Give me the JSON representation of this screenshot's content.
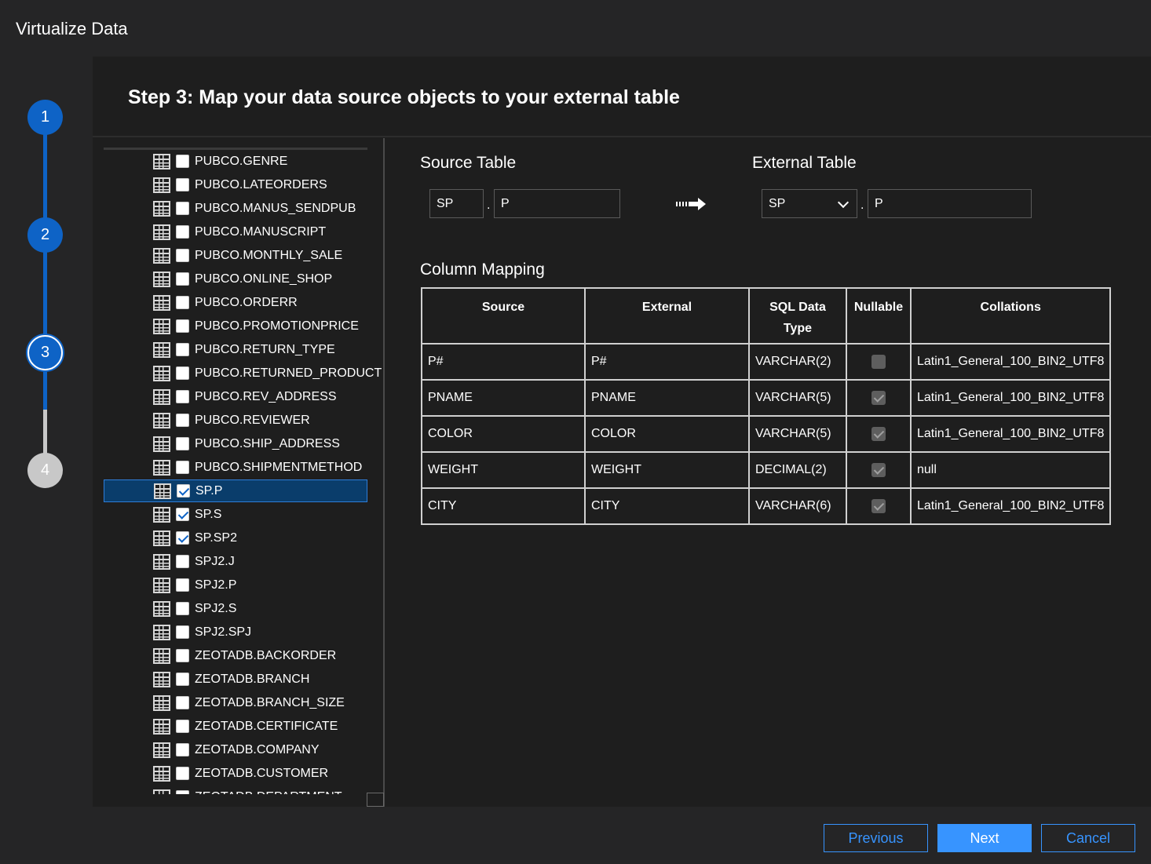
{
  "dialog": {
    "title": "Virtualize Data"
  },
  "stepper": {
    "steps": [
      {
        "label": "1",
        "state": "complete"
      },
      {
        "label": "2",
        "state": "complete"
      },
      {
        "label": "3",
        "state": "active"
      },
      {
        "label": "4",
        "state": "pending"
      }
    ]
  },
  "main": {
    "heading": "Step 3: Map your data source objects to your external table"
  },
  "tree": {
    "items": [
      {
        "label": "PUBCO.GENRE",
        "checked": false
      },
      {
        "label": "PUBCO.LATEORDERS",
        "checked": false
      },
      {
        "label": "PUBCO.MANUS_SENDPUB",
        "checked": false
      },
      {
        "label": "PUBCO.MANUSCRIPT",
        "checked": false
      },
      {
        "label": "PUBCO.MONTHLY_SALE",
        "checked": false
      },
      {
        "label": "PUBCO.ONLINE_SHOP",
        "checked": false
      },
      {
        "label": "PUBCO.ORDERR",
        "checked": false
      },
      {
        "label": "PUBCO.PROMOTIONPRICE",
        "checked": false
      },
      {
        "label": "PUBCO.RETURN_TYPE",
        "checked": false
      },
      {
        "label": "PUBCO.RETURNED_PRODUCT",
        "checked": false
      },
      {
        "label": "PUBCO.REV_ADDRESS",
        "checked": false
      },
      {
        "label": "PUBCO.REVIEWER",
        "checked": false
      },
      {
        "label": "PUBCO.SHIP_ADDRESS",
        "checked": false
      },
      {
        "label": "PUBCO.SHIPMENTMETHOD",
        "checked": false
      },
      {
        "label": "SP.P",
        "checked": true,
        "selected": true
      },
      {
        "label": "SP.S",
        "checked": true
      },
      {
        "label": "SP.SP2",
        "checked": true
      },
      {
        "label": "SPJ2.J",
        "checked": false
      },
      {
        "label": "SPJ2.P",
        "checked": false
      },
      {
        "label": "SPJ2.S",
        "checked": false
      },
      {
        "label": "SPJ2.SPJ",
        "checked": false
      },
      {
        "label": "ZEOTADB.BACKORDER",
        "checked": false
      },
      {
        "label": "ZEOTADB.BRANCH",
        "checked": false
      },
      {
        "label": "ZEOTADB.BRANCH_SIZE",
        "checked": false
      },
      {
        "label": "ZEOTADB.CERTIFICATE",
        "checked": false
      },
      {
        "label": "ZEOTADB.COMPANY",
        "checked": false
      },
      {
        "label": "ZEOTADB.CUSTOMER",
        "checked": false
      },
      {
        "label": "ZEOTADB.DEPARTMENT",
        "checked": false
      }
    ]
  },
  "source_table": {
    "label": "Source Table",
    "schema": "SP",
    "table": "P",
    "separator": "."
  },
  "external_table": {
    "label": "External Table",
    "schema": "SP",
    "table": "P",
    "separator": "."
  },
  "column_mapping": {
    "label": "Column Mapping",
    "headers": {
      "source": "Source",
      "external": "External",
      "sql_type_line1": "SQL Data",
      "sql_type_line2": "Type",
      "nullable": "Nullable",
      "collations": "Collations"
    },
    "rows": [
      {
        "source": "P#",
        "external": "P#",
        "type": "VARCHAR(2)",
        "nullable": false,
        "collation": "Latin1_General_100_BIN2_UTF8"
      },
      {
        "source": "PNAME",
        "external": "PNAME",
        "type": "VARCHAR(5)",
        "nullable": true,
        "collation": "Latin1_General_100_BIN2_UTF8"
      },
      {
        "source": "COLOR",
        "external": "COLOR",
        "type": "VARCHAR(5)",
        "nullable": true,
        "collation": "Latin1_General_100_BIN2_UTF8"
      },
      {
        "source": "WEIGHT",
        "external": "WEIGHT",
        "type": "DECIMAL(2)",
        "nullable": true,
        "collation": "null"
      },
      {
        "source": "CITY",
        "external": "CITY",
        "type": "VARCHAR(6)",
        "nullable": true,
        "collation": "Latin1_General_100_BIN2_UTF8"
      }
    ]
  },
  "footer": {
    "previous": "Previous",
    "next": "Next",
    "cancel": "Cancel"
  },
  "colors": {
    "accent": "#3794ff",
    "step_blue": "#0e63c6",
    "selected_row": "#0a3d6b"
  }
}
